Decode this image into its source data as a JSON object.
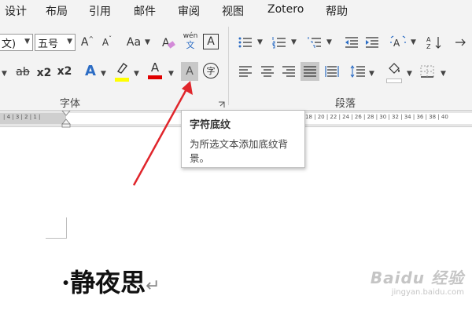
{
  "tabs": [
    "设计",
    "布局",
    "引用",
    "邮件",
    "审阅",
    "视图",
    "Zotero",
    "帮助"
  ],
  "font": {
    "name_value": "文)",
    "size_value": "五号",
    "grow_label": "A",
    "shrink_label": "A",
    "case_label": "Aa",
    "phonetic_top": "wén",
    "phonetic_bottom": "文",
    "border_char_label": "A",
    "strike_label": "ab",
    "sub_label": "x2",
    "sup_label": "x2",
    "effects_label": "A",
    "highlight_label": "ab",
    "font_color_label": "A",
    "shading_label": "A",
    "enclose_label": "字",
    "group_label": "字体"
  },
  "paragraph": {
    "group_label": "段落"
  },
  "colors": {
    "highlight": "#ffff00",
    "font_color": "#e00000",
    "arrow": "#e0252b",
    "accent": "#2b579a"
  },
  "tooltip": {
    "title": "字符底纹",
    "description": "为所选文本添加底纹背景。"
  },
  "ruler": {
    "left_marks": "| 4 | 3 | 2 | 1 |",
    "right_marks": "18 | 20 | 22 | 24 | 26 | 28 | 30 | 32 | 34 | 36 | 38 | 40"
  },
  "document": {
    "title": "静夜思",
    "bullet": "·",
    "paragraph_mark": "↵"
  },
  "watermark": {
    "logo": "Baidu 经验",
    "url": "jingyan.baidu.com"
  }
}
